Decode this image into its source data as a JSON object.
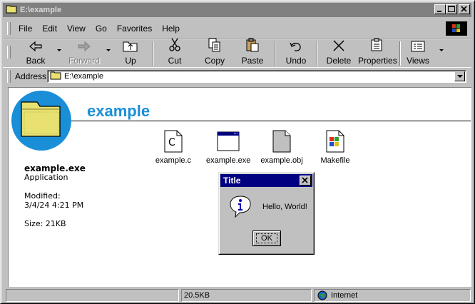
{
  "window": {
    "title": "E:\\example"
  },
  "menu": [
    "File",
    "Edit",
    "View",
    "Go",
    "Favorites",
    "Help"
  ],
  "toolbar": {
    "back": "Back",
    "forward": "Forward",
    "up": "Up",
    "cut": "Cut",
    "copy": "Copy",
    "paste": "Paste",
    "undo": "Undo",
    "delete": "Delete",
    "properties": "Properties",
    "views": "Views"
  },
  "address": {
    "label": "Address",
    "value": "E:\\example"
  },
  "folder": {
    "heading": "example",
    "selected_name": "example.exe",
    "selected_type": "Application",
    "modified_label": "Modified:",
    "modified_value": "3/4/24 4:21 PM",
    "size": "Size: 21KB"
  },
  "files": [
    {
      "name": "example.c",
      "icon": "c-source-file-icon"
    },
    {
      "name": "example.exe",
      "icon": "application-window-icon"
    },
    {
      "name": "example.obj",
      "icon": "blank-file-icon"
    },
    {
      "name": "Makefile",
      "icon": "windows-document-icon"
    }
  ],
  "dialog": {
    "title": "Title",
    "message": "Hello, World!",
    "ok": "OK"
  },
  "status": {
    "size": "20.5KB",
    "zone": "Internet"
  },
  "colors": {
    "accent": "#1a8fd8",
    "dialog_title": "#000080",
    "desktop": "#008080"
  }
}
